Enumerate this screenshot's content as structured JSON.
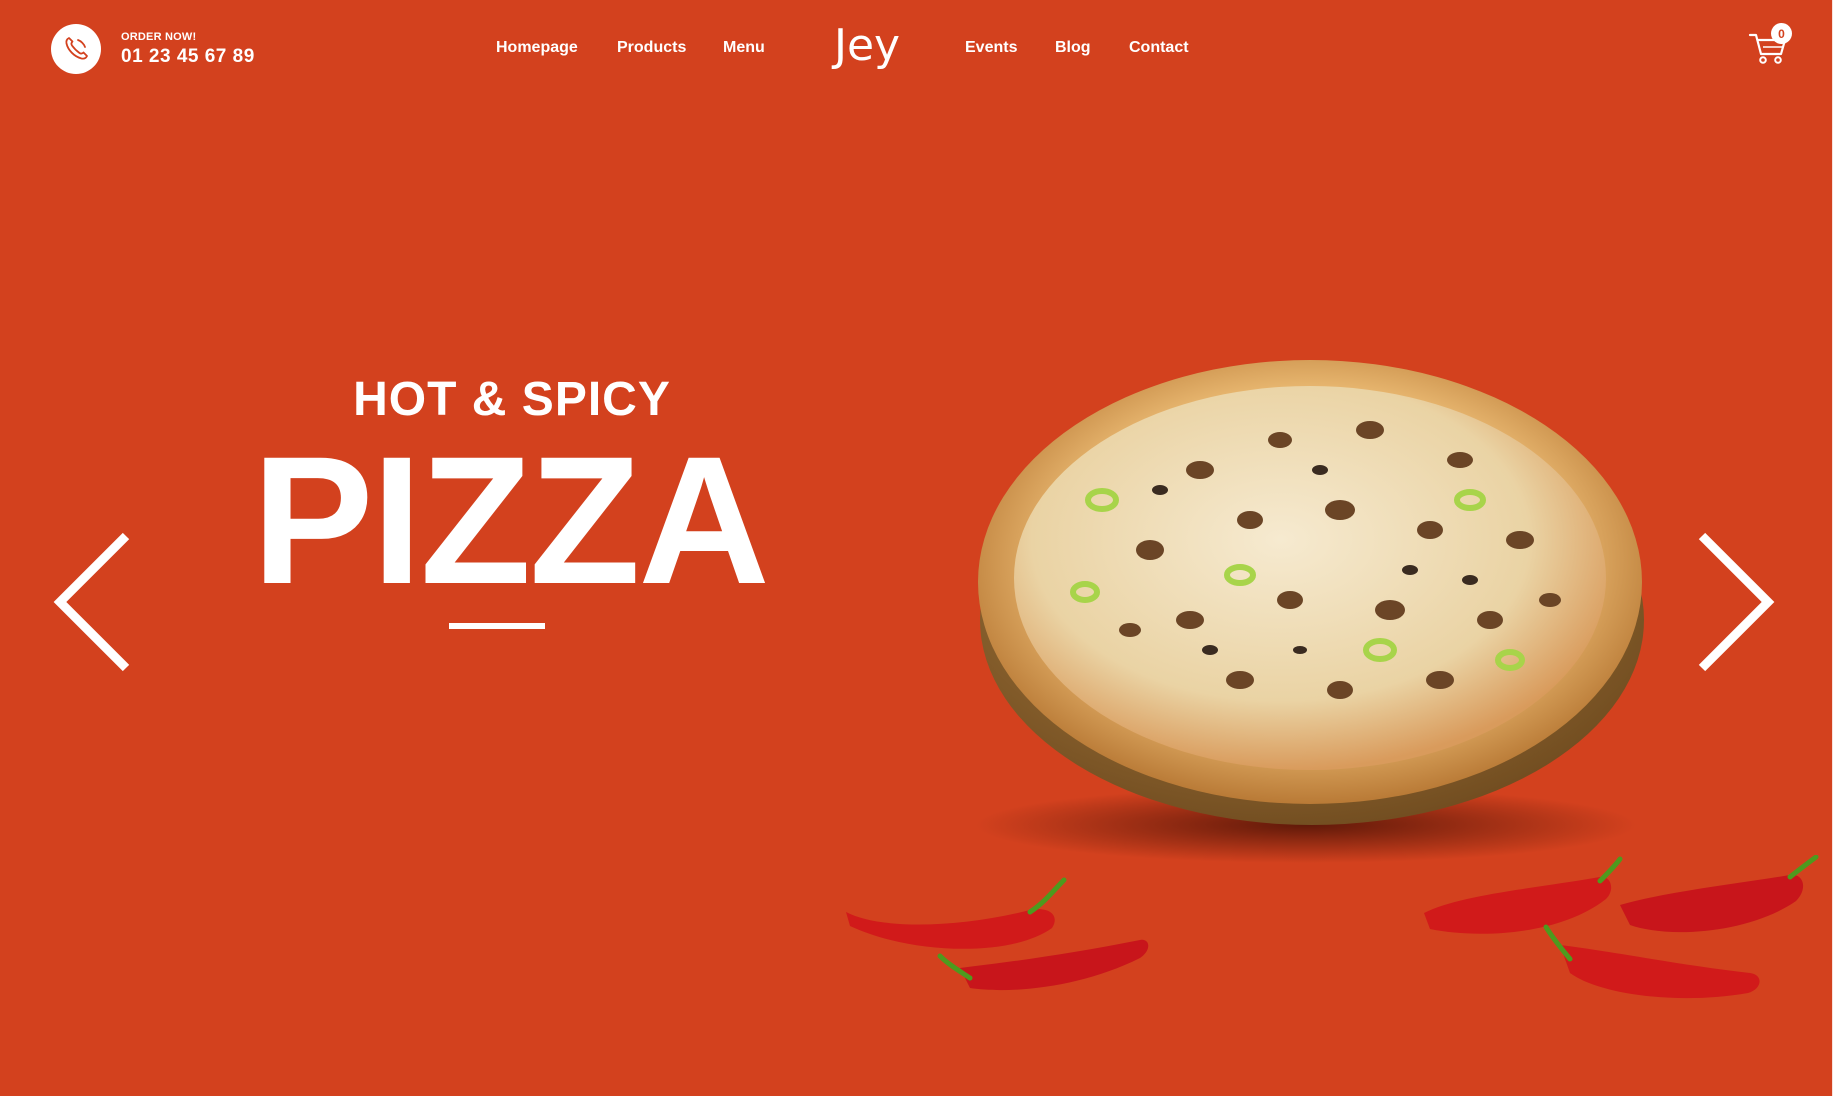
{
  "header": {
    "order_label": "ORDER NOW!",
    "phone_number": "01 23 45 67 89",
    "nav_left": [
      "Homepage",
      "Products",
      "Menu"
    ],
    "logo": "Jey",
    "nav_right": [
      "Events",
      "Blog",
      "Contact"
    ],
    "cart_count": "0"
  },
  "hero": {
    "subtitle": "HOT & SPICY",
    "title": "PIZZA"
  },
  "icons": {
    "phone": "phone-icon",
    "cart": "cart-icon",
    "prev": "chevron-left-icon",
    "next": "chevron-right-icon"
  },
  "colors": {
    "background": "#d3411e",
    "text": "#ffffff",
    "pepper": "#d11a1a",
    "stem": "#4e9a1e"
  }
}
